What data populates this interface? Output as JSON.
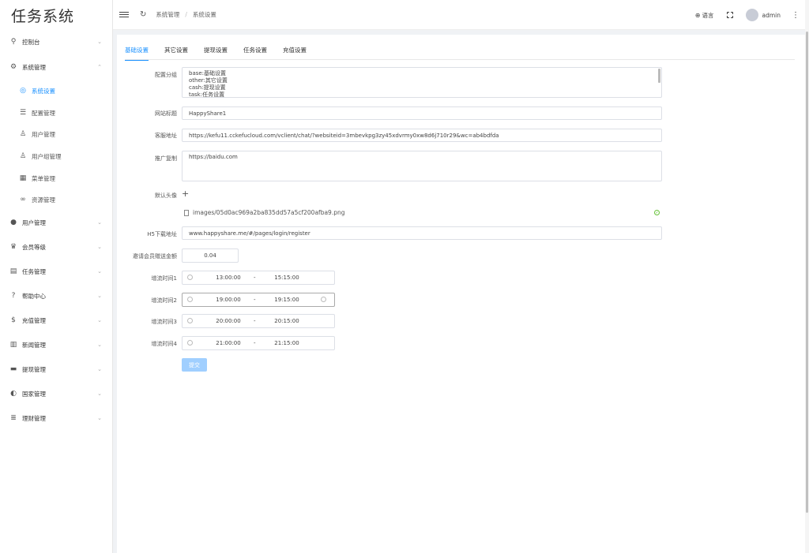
{
  "app": {
    "title": "任务系统"
  },
  "sidebar": {
    "items": [
      {
        "label": "控制台",
        "icon": "filter-icon"
      },
      {
        "label": "系统管理",
        "icon": "gear-icon"
      },
      {
        "label": "系统设置",
        "icon": "cog-circle-icon"
      },
      {
        "label": "配置管理",
        "icon": "sliders-icon"
      },
      {
        "label": "用户管理",
        "icon": "user-outline-icon"
      },
      {
        "label": "用户组管理",
        "icon": "users-outline-icon"
      },
      {
        "label": "菜单管理",
        "icon": "grid-icon"
      },
      {
        "label": "资源管理",
        "icon": "link-icon"
      },
      {
        "label": "用户管理",
        "icon": "user-icon"
      },
      {
        "label": "会员等级",
        "icon": "crown-icon"
      },
      {
        "label": "任务管理",
        "icon": "clipboard-icon"
      },
      {
        "label": "帮助中心",
        "icon": "question-icon"
      },
      {
        "label": "充值管理",
        "icon": "money-bag-icon"
      },
      {
        "label": "新闻管理",
        "icon": "newspaper-icon"
      },
      {
        "label": "提现管理",
        "icon": "wallet-icon"
      },
      {
        "label": "国家管理",
        "icon": "globe-icon"
      },
      {
        "label": "理财管理",
        "icon": "database-icon"
      }
    ]
  },
  "header": {
    "breadcrumb": [
      "系统管理",
      "系统设置"
    ],
    "language": "语言",
    "username": "admin"
  },
  "tabs": [
    "基础设置",
    "其它设置",
    "提现设置",
    "任务设置",
    "充值设置"
  ],
  "form": {
    "config_group": {
      "label": "配置分组",
      "lines": [
        "base:基础设置",
        "other:其它设置",
        "cash:提现设置",
        "task:任务设置"
      ]
    },
    "site_title": {
      "label": "网站标题",
      "value": "HappyShare1"
    },
    "service_url": {
      "label": "客服地址",
      "value": "https://kefu11.cckefucloud.com/vclient/chat/?websiteid=3mbevkpg3zy45xdvrmy0xw8d6j710r29&wc=ab4bdfda"
    },
    "promo_copy": {
      "label": "推广复制",
      "value": "https://baidu.com"
    },
    "default_avatar": {
      "label": "默认头像",
      "file": "images/05d0ac969a2ba835dd57a5cf200afba9.png"
    },
    "h5_download": {
      "label": "H5下载地址",
      "value": "www.happyshare.me/#/pages/login/register"
    },
    "invite_bonus": {
      "label": "邀请会员赠送金额",
      "value": "0.04"
    },
    "slots": [
      {
        "label": "增流时间1",
        "start": "13:00:00",
        "end": "15:15:00"
      },
      {
        "label": "增流时间2",
        "start": "19:00:00",
        "end": "19:15:00"
      },
      {
        "label": "增流时间3",
        "start": "20:00:00",
        "end": "20:15:00"
      },
      {
        "label": "增流时间4",
        "start": "21:00:00",
        "end": "21:15:00"
      }
    ],
    "range_sep": "-",
    "submit_label": "提交"
  }
}
